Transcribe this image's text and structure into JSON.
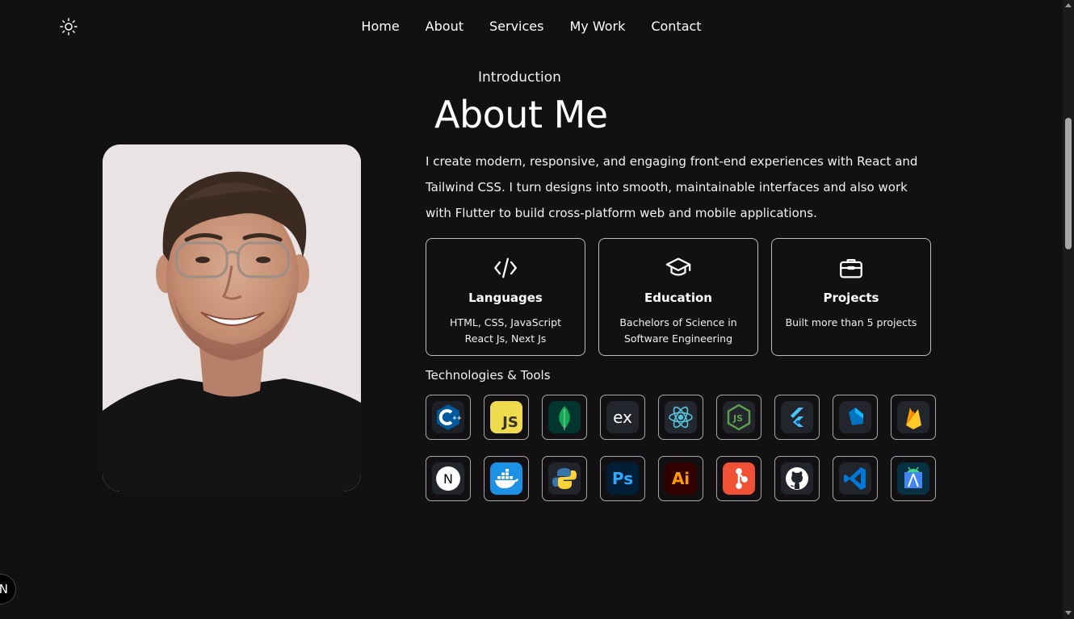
{
  "nav": {
    "items": [
      {
        "label": "Home"
      },
      {
        "label": "About"
      },
      {
        "label": "Services"
      },
      {
        "label": "My Work"
      },
      {
        "label": "Contact"
      }
    ]
  },
  "about": {
    "eyebrow": "Introduction",
    "title": "About Me",
    "bio": "I create modern, responsive, and engaging front-end experiences with React and Tailwind CSS. I turn designs into smooth, maintainable interfaces and also work with Flutter to build cross-platform web and mobile applications."
  },
  "cards": [
    {
      "icon": "code-icon",
      "title": "Languages",
      "line1": "HTML, CSS, JavaScript",
      "line2": "React Js, Next Js"
    },
    {
      "icon": "graduation-cap-icon",
      "title": "Education",
      "line1": "Bachelors of Science in",
      "line2": "Software Engineering"
    },
    {
      "icon": "briefcase-icon",
      "title": "Projects",
      "line1": "Built more than 5 projects",
      "line2": ""
    }
  ],
  "tools": {
    "heading": "Technologies & Tools",
    "row1": [
      "cpp-icon",
      "javascript-icon",
      "mongodb-icon",
      "express-icon",
      "react-icon",
      "nodejs-icon",
      "flutter-icon",
      "dart-icon",
      "firebase-icon"
    ],
    "row2": [
      "nextjs-icon",
      "docker-icon",
      "python-icon",
      "photoshop-icon",
      "illustrator-icon",
      "git-icon",
      "github-icon",
      "vscode-icon",
      "android-studio-icon"
    ],
    "glyphs": {
      "js": "JS",
      "ex": "ex",
      "ps": "Ps",
      "ai": "Ai",
      "n": "N"
    }
  },
  "colors": {
    "background": "#121012",
    "text": "#ffffff",
    "card_border": "#bcbcbc"
  },
  "badge": {
    "label": "N"
  }
}
